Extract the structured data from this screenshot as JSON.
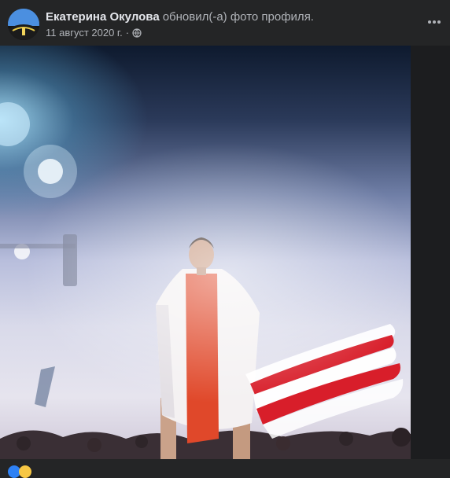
{
  "post": {
    "author_name": "Екатерина Окулова",
    "action_text": "обновил(-а) фото профиля.",
    "date": "11 август 2020 г.",
    "separator": "·",
    "privacy_icon": "globe-icon",
    "more_icon": "more-dots-icon"
  },
  "photo": {
    "subject": "profile-photo",
    "flag_colors": [
      "#ffffff",
      "#e0482a",
      "#ffffff"
    ],
    "brush_colors": [
      "#d81e2a",
      "#ffffff"
    ]
  },
  "reactions": {
    "icons": [
      "like-icon",
      "haha-icon"
    ],
    "colors": [
      "#2e81f4",
      "#f7c744"
    ]
  }
}
